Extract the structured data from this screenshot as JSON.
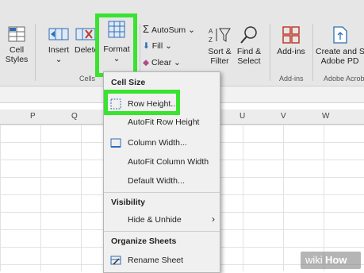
{
  "ribbon": {
    "cell_styles_label_1": "Cell",
    "cell_styles_label_2": "Styles",
    "insert_label": "Insert",
    "delete_label": "Delete",
    "format_label": "Format",
    "autosum_label": "AutoSum",
    "fill_label": "Fill",
    "clear_label": "Clear",
    "sort_filter_label_1": "Sort &",
    "sort_filter_label_2": "Filter",
    "find_select_label_1": "Find &",
    "find_select_label_2": "Select",
    "addins_label": "Add-ins",
    "create_share_label_1": "Create and Sh",
    "create_share_label_2": "Adobe PD",
    "group_cells": "Cells",
    "group_addins": "Add-ins",
    "group_adobe": "Adobe Acrob"
  },
  "columns": [
    "P",
    "Q",
    "U",
    "V",
    "W"
  ],
  "menu": {
    "header_cell_size": "Cell Size",
    "row_height": "Row Height...",
    "autofit_row_height": "AutoFit Row Height",
    "column_width": "Column Width...",
    "autofit_column_width": "AutoFit Column Width",
    "default_width": "Default Width...",
    "header_visibility": "Visibility",
    "hide_unhide": "Hide & Unhide",
    "header_organize": "Organize Sheets",
    "rename_sheet": "Rename Sheet"
  },
  "watermark": {
    "wiki": "wiki",
    "how": "How"
  },
  "colors": {
    "highlight": "#39e32f",
    "ribbon_bg": "#e6e6e6",
    "menu_bg": "#f0f0f0",
    "accent_blue": "#2e6db4"
  }
}
